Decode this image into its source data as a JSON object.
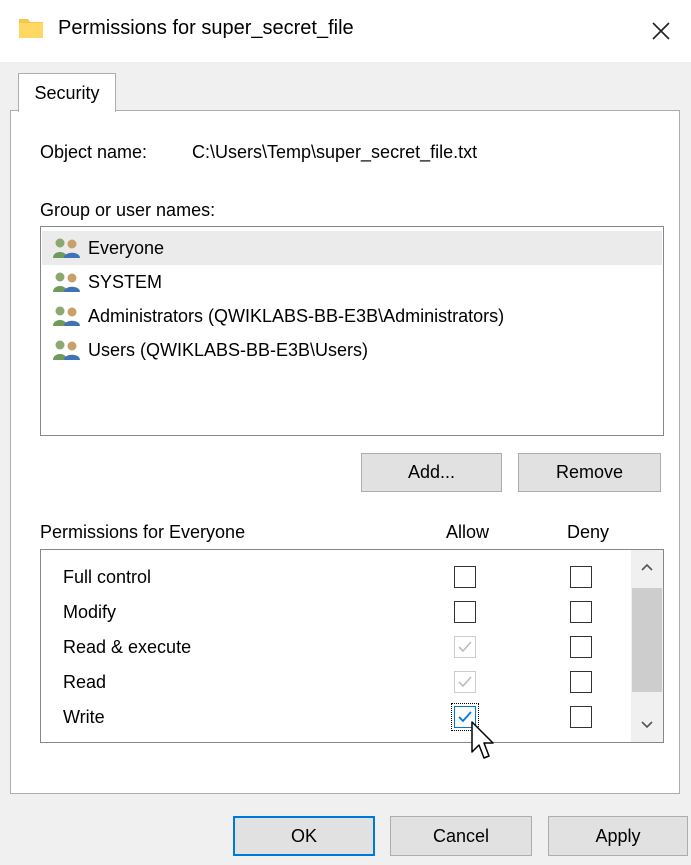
{
  "window": {
    "title": "Permissions for super_secret_file",
    "icon": "folder-icon",
    "close_icon": "close-icon"
  },
  "tabs": [
    {
      "label": "Security",
      "active": true
    }
  ],
  "object": {
    "label": "Object name:",
    "value": "C:\\Users\\Temp\\super_secret_file.txt"
  },
  "groups": {
    "label": "Group or user names:",
    "items": [
      {
        "name": "Everyone",
        "selected": true
      },
      {
        "name": "SYSTEM",
        "selected": false
      },
      {
        "name": "Administrators (QWIKLABS-BB-E3B\\Administrators)",
        "selected": false
      },
      {
        "name": "Users (QWIKLABS-BB-E3B\\Users)",
        "selected": false
      }
    ],
    "icon": "users-icon"
  },
  "buttons": {
    "add": "Add...",
    "remove": "Remove",
    "ok": "OK",
    "cancel": "Cancel",
    "apply": "Apply"
  },
  "permissions": {
    "label": "Permissions for Everyone",
    "allow_header": "Allow",
    "deny_header": "Deny",
    "rows": [
      {
        "name": "Full control",
        "allow": "unchecked",
        "deny": "unchecked"
      },
      {
        "name": "Modify",
        "allow": "unchecked",
        "deny": "unchecked"
      },
      {
        "name": "Read & execute",
        "allow": "checked-disabled",
        "deny": "unchecked"
      },
      {
        "name": "Read",
        "allow": "checked-disabled",
        "deny": "unchecked"
      },
      {
        "name": "Write",
        "allow": "checked-focused",
        "deny": "unchecked"
      }
    ]
  },
  "colors": {
    "accent": "#0078d7",
    "button": "#e1e1e1",
    "window": "#f0f0f0",
    "panel": "#ffffff",
    "selected_row": "#ebebeb"
  }
}
